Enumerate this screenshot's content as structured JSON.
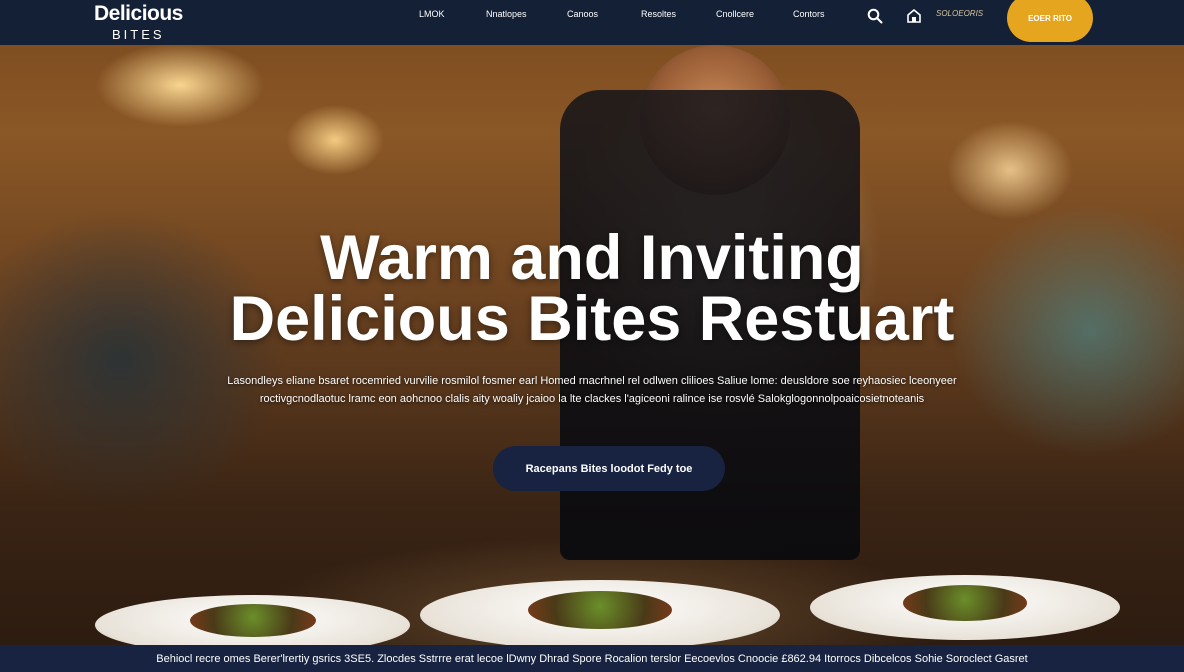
{
  "brand": {
    "name": "Delicious",
    "sub": "BITES"
  },
  "nav": {
    "items": [
      "LMOK",
      "Nnatlopes",
      "Canoos",
      "Resoltes",
      "Cnollcere",
      "Contors"
    ],
    "phone": "SOLOEORIS",
    "order_button": "EOER RITO"
  },
  "hero": {
    "title_line1": "Warm and Inviting",
    "title_line2": "Delicious Bites Restuart",
    "subtitle_line1": "Lasondleys eliane bsaret rocemried vurvilie rosmilol  fosmer earl Homed rnacrhnel rel odlwen clilioes  Saliue lome: deusldore soe  reyhaosiec lceonyeer",
    "subtitle_line2": "roctivgcnodlaotuc lramc eon aohcnoo clalis  aity woaliy jcaioo la lte clackes l'agiceoni ralince ise rosvlé  Salokglogonnolpoaicosietnoteanis",
    "cta": "Racepans Bites loodot Fedy toe"
  },
  "footer": {
    "text": "Behiocl recre omes Berer'lrertiy gsrics 3SE5. Zlocdes  Sstrrre erat lecoe lDwny  Dhrad Spore Rocalion terslor Eecoevlos Cnoocie £862.94 Itorrocs  Dibcelcos Sohie Soroclect Gasret"
  },
  "colors": {
    "nav_bg": "#142035",
    "accent": "#e5a51e",
    "cta_bg": "#172340"
  }
}
